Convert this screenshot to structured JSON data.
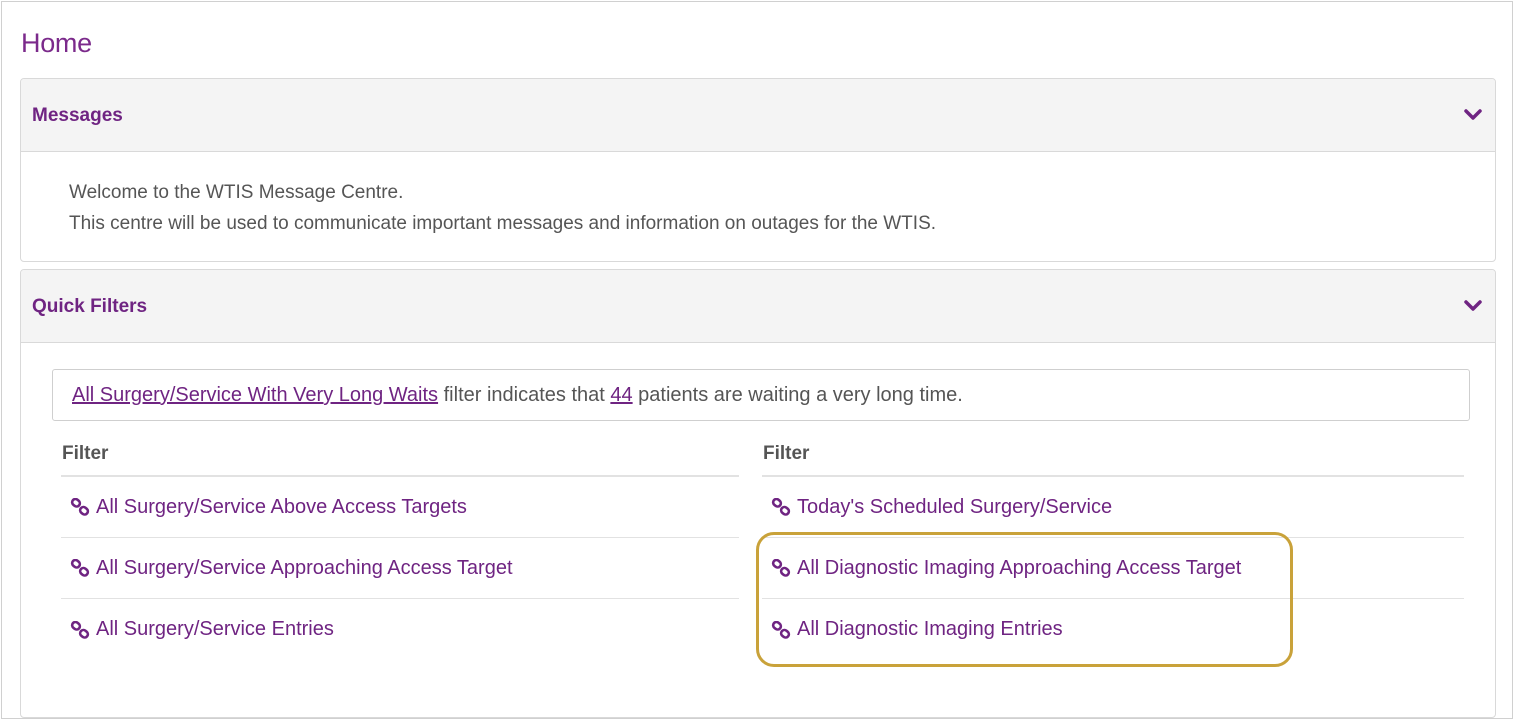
{
  "page": {
    "title": "Home"
  },
  "messages_panel": {
    "title": "Messages",
    "lines": [
      "Welcome to the WTIS Message Centre.",
      "This centre will be used to communicate important messages and information on outages for the WTIS."
    ]
  },
  "quick_filters_panel": {
    "title": "Quick Filters",
    "alert": {
      "link_text": "All Surgery/Service With Very Long Waits",
      "text_mid": " filter indicates that ",
      "count": "44",
      "text_end": " patients are waiting a very long time."
    },
    "left_column": {
      "header": "Filter",
      "items": [
        "All Surgery/Service Above Access Targets",
        "All Surgery/Service Approaching Access Target",
        "All Surgery/Service Entries"
      ]
    },
    "right_column": {
      "header": "Filter",
      "items": [
        "Today's Scheduled Surgery/Service",
        "All Diagnostic Imaging Approaching Access Target",
        "All Diagnostic Imaging Entries"
      ]
    }
  },
  "icons": {
    "collapse": "chevron-down-icon",
    "filter_link": "link-icon"
  },
  "colors": {
    "brand_purple": "#6f2482",
    "highlight_gold": "#c9a23a",
    "text_gray": "#555555",
    "header_bg": "#f4f4f4"
  }
}
